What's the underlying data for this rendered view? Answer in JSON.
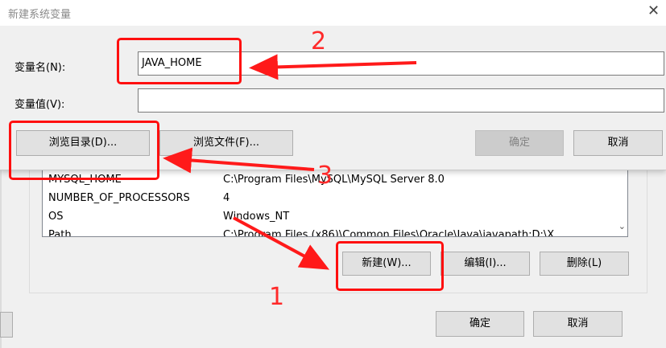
{
  "dialog": {
    "title": "新建系统变量",
    "name_label": "变量名(N):",
    "name_value": "JAVA_HOME",
    "value_label": "变量值(V):",
    "value_value": "",
    "browse_dir_label": "浏览目录(D)...",
    "browse_file_label": "浏览文件(F)...",
    "ok_label": "确定",
    "cancel_label": "取消"
  },
  "parent": {
    "variables": [
      {
        "name": "MYSQL_HOME",
        "value": "C:\\Program Files\\MySQL\\MySQL Server 8.0"
      },
      {
        "name": "NUMBER_OF_PROCESSORS",
        "value": "4"
      },
      {
        "name": "OS",
        "value": "Windows_NT"
      },
      {
        "name": "Path",
        "value": "C:\\Program Files (x86)\\Common Files\\Oracle\\Java\\javapath;D:\\X"
      }
    ],
    "new_label": "新建(W)...",
    "edit_label": "编辑(I)...",
    "delete_label": "删除(L)",
    "ok_label": "确定",
    "cancel_label": "取消"
  },
  "annotations": {
    "step1": "1",
    "step2": "2",
    "step3": "3",
    "color": "#ff1a1a"
  },
  "icons": {
    "close": "close-icon",
    "scroll_down": "chevron-down-icon"
  }
}
